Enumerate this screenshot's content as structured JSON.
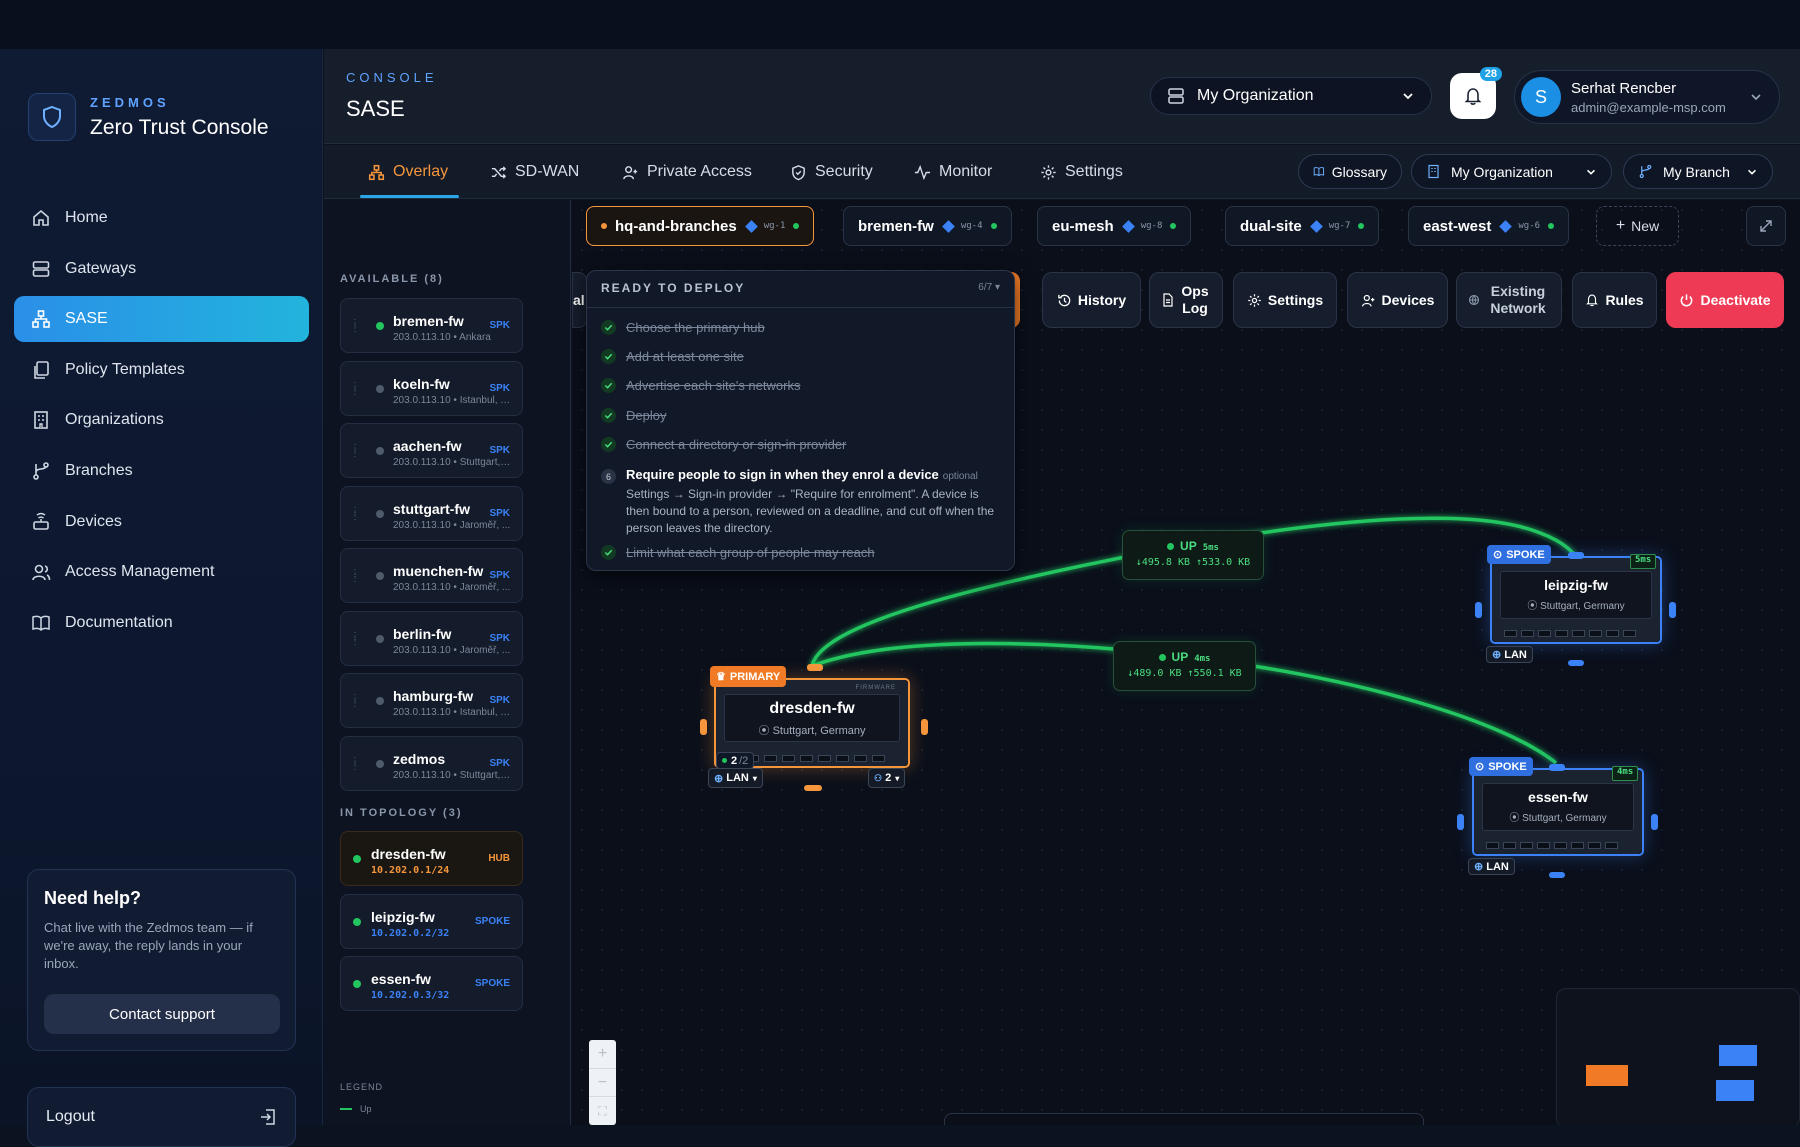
{
  "brand": {
    "small": "ZEDMOS",
    "title": "Zero Trust Console"
  },
  "nav": {
    "items": [
      {
        "label": "Home",
        "icon": "home-icon"
      },
      {
        "label": "Gateways",
        "icon": "server-icon"
      },
      {
        "label": "SASE",
        "icon": "network-icon"
      },
      {
        "label": "Policy Templates",
        "icon": "copy-icon"
      },
      {
        "label": "Organizations",
        "icon": "building-icon"
      },
      {
        "label": "Branches",
        "icon": "branch-icon"
      },
      {
        "label": "Devices",
        "icon": "device-icon"
      },
      {
        "label": "Access Management",
        "icon": "users-icon"
      },
      {
        "label": "Documentation",
        "icon": "book-icon"
      }
    ],
    "active": "SASE"
  },
  "help": {
    "title": "Need help?",
    "text": "Chat live with the Zedmos team — if we're away, the reply lands in your inbox.",
    "button": "Contact support"
  },
  "logout": "Logout",
  "header": {
    "section_small": "CONSOLE",
    "section_title": "SASE",
    "org": "My Organization",
    "notifications": "28",
    "user": {
      "initial": "S",
      "name": "Serhat Rencber",
      "email": "admin@example-msp.com"
    }
  },
  "tabs": {
    "items": [
      "Overlay",
      "SD-WAN",
      "Private Access",
      "Security",
      "Monitor",
      "Settings"
    ],
    "active": "Overlay",
    "glossary": "Glossary",
    "org": "My Organization",
    "branch": "My Branch"
  },
  "available": {
    "title": "AVAILABLE (8)",
    "devices": [
      {
        "name": "bremen-fw",
        "sub": "203.0.113.10 • Ankara",
        "tag": "SPK",
        "online": true
      },
      {
        "name": "koeln-fw",
        "sub": "203.0.113.10 • Istanbul, T...",
        "tag": "SPK",
        "online": false
      },
      {
        "name": "aachen-fw",
        "sub": "203.0.113.10 • Stuttgart, ...",
        "tag": "SPK",
        "online": false
      },
      {
        "name": "stuttgart-fw",
        "sub": "203.0.113.10 • Jaroměř, ...",
        "tag": "SPK",
        "online": false
      },
      {
        "name": "muenchen-fw",
        "sub": "203.0.113.10 • Jaroměř, ...",
        "tag": "SPK",
        "online": false
      },
      {
        "name": "berlin-fw",
        "sub": "203.0.113.10 • Jaroměř, ...",
        "tag": "SPK",
        "online": false
      },
      {
        "name": "hamburg-fw",
        "sub": "203.0.113.10 • Istanbul, T...",
        "tag": "SPK",
        "online": false
      },
      {
        "name": "zedmos",
        "sub": "203.0.113.10 • Stuttgart, ...",
        "tag": "SPK",
        "online": false
      }
    ]
  },
  "topology": {
    "title": "IN TOPOLOGY (3)",
    "devices": [
      {
        "name": "dresden-fw",
        "ip": "10.202.0.1/24",
        "tag": "HUB",
        "color": "#f5963c"
      },
      {
        "name": "leipzig-fw",
        "ip": "10.202.0.2/32",
        "tag": "SPOKE",
        "color": "#3b82f6"
      },
      {
        "name": "essen-fw",
        "ip": "10.202.0.3/32",
        "tag": "SPOKE",
        "color": "#3b82f6"
      }
    ]
  },
  "legend": {
    "title": "LEGEND",
    "up": "Up"
  },
  "overlays": [
    {
      "name": "hq-and-branches",
      "wg": "wg-1",
      "active": true
    },
    {
      "name": "bremen-fw",
      "wg": "wg-4"
    },
    {
      "name": "eu-mesh",
      "wg": "wg-8"
    },
    {
      "name": "dual-site",
      "wg": "wg-7"
    },
    {
      "name": "east-west",
      "wg": "wg-6"
    }
  ],
  "new_label": "New",
  "actions": {
    "partial_left": "al",
    "history": "History",
    "ops_log": "Ops Log",
    "settings": "Settings",
    "devices": "Devices",
    "existing_network": "Existing Network",
    "rules": "Rules",
    "deactivate": "Deactivate"
  },
  "checklist": {
    "title": "READY TO DEPLOY",
    "count": "6/7",
    "items": [
      "Choose the primary hub",
      "Add at least one site",
      "Advertise each site's networks",
      "Deploy",
      "Connect a directory or sign-in provider"
    ],
    "step6": {
      "num": "6",
      "title": "Require people to sign in when they enrol a device",
      "optional": "optional",
      "desc": "Settings → Sign-in provider → \"Require for enrolment\". A device is then bound to a person, reviewed on a deadline, and cut off when the person leaves the directory."
    },
    "last": "Limit what each group of people may reach"
  },
  "nodes": {
    "hub": {
      "badge": "PRIMARY",
      "name": "dresden-fw",
      "location": "Stuttgart, Germany",
      "lan": "LAN",
      "peers": "2",
      "count": "2",
      "count_total": "/2",
      "vendor": "FIRMWARE"
    },
    "spoke1": {
      "badge": "SPOKE",
      "name": "leipzig-fw",
      "location": "Stuttgart, Germany",
      "lan": "LAN",
      "latency": "5ms"
    },
    "spoke2": {
      "badge": "SPOKE",
      "name": "essen-fw",
      "location": "Stuttgart, Germany",
      "lan": "LAN",
      "latency": "4ms"
    }
  },
  "links": [
    {
      "status": "UP",
      "latency": "5ms",
      "traffic": "↓495.8 KB ↑533.0 KB"
    },
    {
      "status": "UP",
      "latency": "4ms",
      "traffic": "↓489.0 KB ↑550.1 KB"
    }
  ],
  "colors": {
    "accent": "#2aa6e6",
    "hub": "#f5963c",
    "spoke": "#3b82f6",
    "up": "#22c55e",
    "danger": "#ee3a55"
  }
}
